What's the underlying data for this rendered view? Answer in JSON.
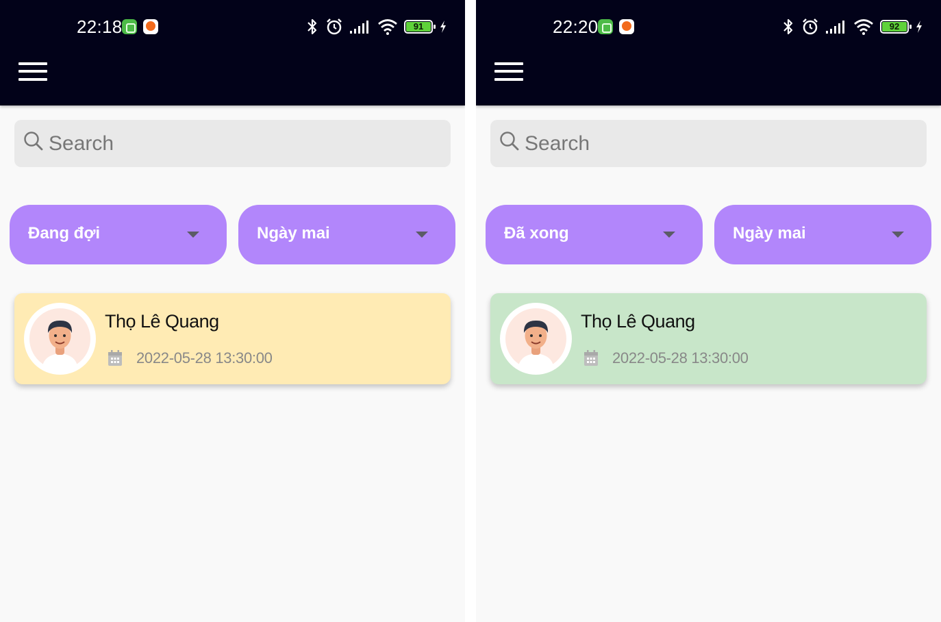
{
  "colors": {
    "appbar": "#020219",
    "dropdown": "#b286fb",
    "search_bg": "#e9e9e9",
    "card_pending": "#ffebb4",
    "card_done": "#c8e6c9"
  },
  "screens": [
    {
      "status": {
        "time": "22:18",
        "battery": "91"
      },
      "search": {
        "placeholder": "Search"
      },
      "filters": {
        "status_label": "Đang đợi",
        "date_label": "Ngày mai"
      },
      "card": {
        "name": "Thọ Lê Quang",
        "datetime": "2022-05-28 13:30:00",
        "bg": "#ffebb4"
      }
    },
    {
      "status": {
        "time": "22:20",
        "battery": "92"
      },
      "search": {
        "placeholder": "Search"
      },
      "filters": {
        "status_label": "Đã xong",
        "date_label": "Ngày mai"
      },
      "card": {
        "name": "Thọ Lê Quang",
        "datetime": "2022-05-28 13:30:00",
        "bg": "#c8e6c9"
      }
    }
  ]
}
